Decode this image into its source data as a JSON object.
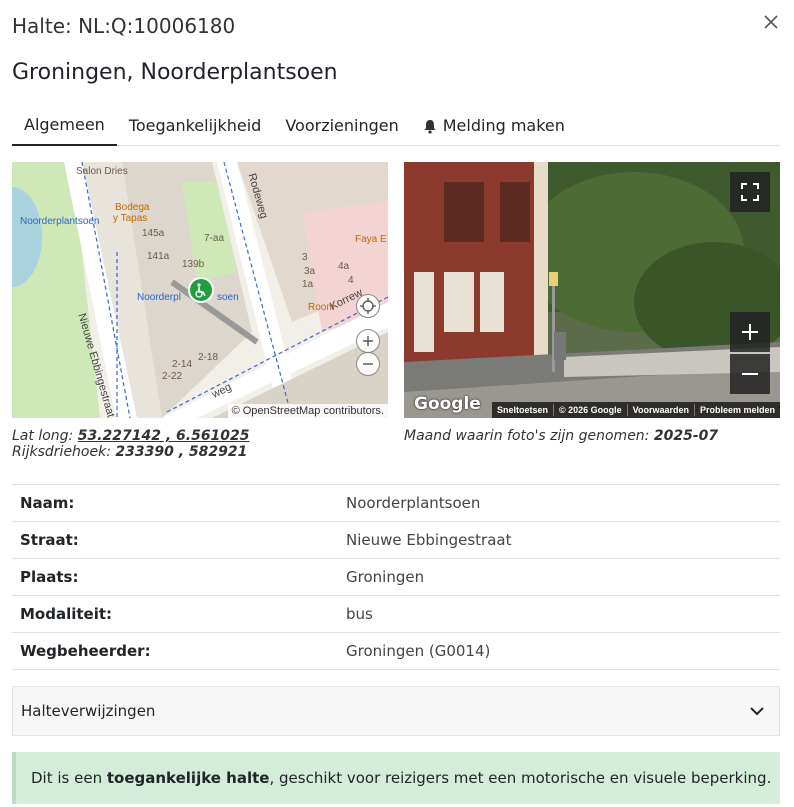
{
  "modal": {
    "title": "Halte: NL:Q:10006180",
    "stop_name": "Groningen, Noorderplantsoen"
  },
  "tabs": [
    {
      "label": "Algemeen",
      "active": true
    },
    {
      "label": "Toegankelijkheid",
      "active": false
    },
    {
      "label": "Voorzieningen",
      "active": false
    },
    {
      "label": "Melding maken",
      "active": false,
      "icon": "bell-icon"
    }
  ],
  "map": {
    "attribution": "© OpenStreetMap contributors.",
    "labels": {
      "salon": "Salon Dries",
      "bodega_1": "Bodega",
      "bodega_2": "y Tapas",
      "stop_top": "Noorderplantsoen",
      "stop_center": "Noorderpl",
      "stop_center_tail": "soen",
      "street_main": "Nieuwe Ebbingestraat",
      "rodeweg": "Rodeweg",
      "korreweg": "Korrew",
      "faya": "Faya E",
      "room": "Room",
      "h145a": "145a",
      "h141a": "141a",
      "h139b": "139b",
      "h7aa": "7-aa",
      "h3": "3",
      "h3a": "3a",
      "h1a": "1a",
      "h4a": "4a",
      "h4": "4",
      "h214": "2-14",
      "h218": "2-18",
      "h222": "2-22",
      "weg": "weg"
    }
  },
  "streetview": {
    "logo": "Google",
    "footer": [
      "Sneltoetsen",
      "© 2026 Google",
      "Voorwaarden",
      "Probleem melden"
    ]
  },
  "coords": {
    "latlong_label": "Lat long:",
    "latlong_value": "53.227142 , 6.561025",
    "rd_label": "Rijksdriehoek:",
    "rd_value": "233390 , 582921"
  },
  "photo": {
    "label": "Maand waarin foto's zijn genomen:",
    "value": "2025-07"
  },
  "info": [
    {
      "key": "Naam:",
      "value": "Noorderplantsoen"
    },
    {
      "key": "Straat:",
      "value": "Nieuwe Ebbingestraat"
    },
    {
      "key": "Plaats:",
      "value": "Groningen"
    },
    {
      "key": "Modaliteit:",
      "value": "bus"
    },
    {
      "key": "Wegbeheerder:",
      "value": "Groningen (G0014)"
    }
  ],
  "accordion": {
    "label": "Halteverwijzingen"
  },
  "alert": {
    "pre": "Dit is een ",
    "bold": "toegankelijke halte",
    "post": ", geschikt voor reizigers met een motorische en visuele beperking."
  },
  "colors": {
    "alert_bg": "#d4edda",
    "stop_marker": "#1e9e3e",
    "map_water": "#aad3df",
    "map_park": "#c8e6b0"
  }
}
